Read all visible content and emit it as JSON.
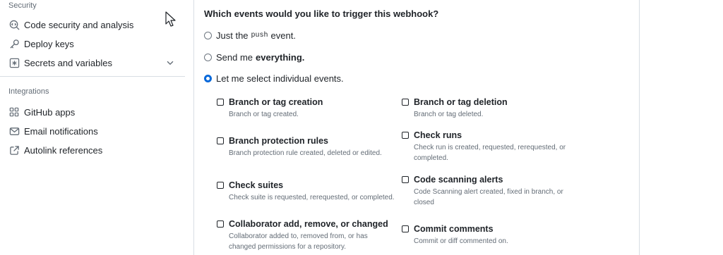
{
  "sidebar": {
    "security_heading": "Security",
    "security_items": [
      {
        "label": "Code security and analysis",
        "icon": "codescan-icon"
      },
      {
        "label": "Deploy keys",
        "icon": "key-icon"
      },
      {
        "label": "Secrets and variables",
        "icon": "asterisk-box-icon"
      }
    ],
    "integrations_heading": "Integrations",
    "integrations_items": [
      {
        "label": "GitHub apps",
        "icon": "apps-icon"
      },
      {
        "label": "Email notifications",
        "icon": "mail-icon"
      },
      {
        "label": "Autolink references",
        "icon": "link-external-icon"
      }
    ]
  },
  "webhook": {
    "question": "Which events would you like to trigger this webhook?",
    "option_push_prefix": "Just the",
    "option_push_code": "push",
    "option_push_suffix": "event.",
    "option_everything_prefix": "Send me",
    "option_everything_bold": "everything.",
    "option_select": "Let me select individual events.",
    "selected_option": "select",
    "events_left": [
      {
        "title": "Branch or tag creation",
        "desc": "Branch or tag created."
      },
      {
        "title": "Branch protection rules",
        "desc": "Branch protection rule created, deleted or edited."
      },
      {
        "title": "Check suites",
        "desc": "Check suite is requested, rerequested, or completed."
      },
      {
        "title": "Collaborator add, remove, or changed",
        "desc": "Collaborator added to, removed from, or has changed permissions for a repository."
      }
    ],
    "events_right": [
      {
        "title": "Branch or tag deletion",
        "desc": "Branch or tag deleted."
      },
      {
        "title": "Check runs",
        "desc": "Check run is created, requested, rerequested, or completed."
      },
      {
        "title": "Code scanning alerts",
        "desc": "Code Scanning alert created, fixed in branch, or closed"
      },
      {
        "title": "Commit comments",
        "desc": "Commit or diff commented on."
      }
    ]
  },
  "colors": {
    "accent": "#0969da",
    "muted_text": "#636c76",
    "border": "#d8dee4"
  }
}
